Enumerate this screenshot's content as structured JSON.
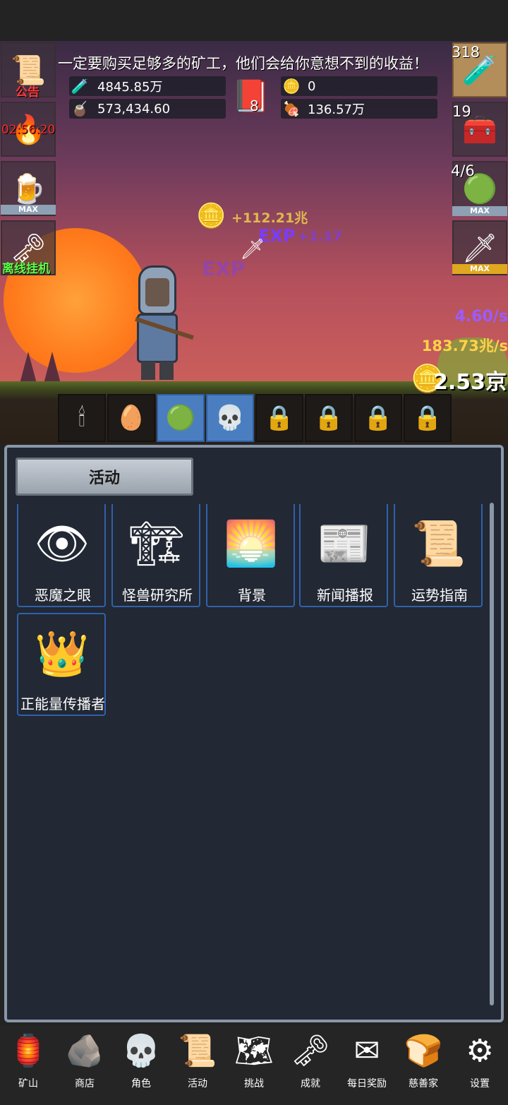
{
  "announcement": "一定要购买足够多的矿工，他们会给你意想不到的收益！",
  "resources": {
    "blue_potion": "4845.85万",
    "green_potion": "573,434.60",
    "book_count": "8",
    "coin_alt": "0",
    "meat": "136.57万"
  },
  "left_buttons": {
    "notice_label": "公告",
    "timer": "02:56:20",
    "max_label": "MAX",
    "offline_label": "离线挂机"
  },
  "right_buttons": {
    "potion_count": "318",
    "chest_count": "19",
    "slime_count": "4/6",
    "max_label": "MAX"
  },
  "combat": {
    "coin_gain": "+112.21兆",
    "exp_label": "EXP",
    "exp_gain": "+1.17",
    "exp_rate": "4.60/s",
    "coin_rate": "183.73兆/s",
    "total_coins": "2.53京"
  },
  "creatures": [
    {
      "icon": "🕯"
    },
    {
      "icon": "🥚"
    },
    {
      "icon": "🟢"
    },
    {
      "icon": "💀"
    },
    {
      "icon": "🔒"
    },
    {
      "icon": "🔒"
    },
    {
      "icon": "🔒"
    },
    {
      "icon": "🔒"
    }
  ],
  "panel": {
    "title": "活动",
    "items": [
      {
        "label": "恶魔之眼",
        "icon": "👁"
      },
      {
        "label": "怪兽研究所",
        "icon": "🏗"
      },
      {
        "label": "背景",
        "icon": "🌅"
      },
      {
        "label": "新闻播报",
        "icon": "📰"
      },
      {
        "label": "运势指南",
        "icon": "📜"
      },
      {
        "label": "正能量传播者",
        "icon": "👑"
      }
    ]
  },
  "nav": [
    {
      "label": "矿山",
      "icon": "🏮"
    },
    {
      "label": "商店",
      "icon": "🪨"
    },
    {
      "label": "角色",
      "icon": "💀"
    },
    {
      "label": "活动",
      "icon": "📜"
    },
    {
      "label": "挑战",
      "icon": "🗺"
    },
    {
      "label": "成就",
      "icon": "🗝"
    },
    {
      "label": "每日奖励",
      "icon": "✉"
    },
    {
      "label": "慈善家",
      "icon": "🍞"
    },
    {
      "label": "设置",
      "icon": "⚙"
    }
  ],
  "colors": {
    "panel_bg": "#222834",
    "item_border": "#2f62aa",
    "timer_red": "#ff2a2a",
    "offline_green": "#5cff4a",
    "exp_purple": "#9a5cff",
    "coin_yellow": "#ffd24a"
  }
}
